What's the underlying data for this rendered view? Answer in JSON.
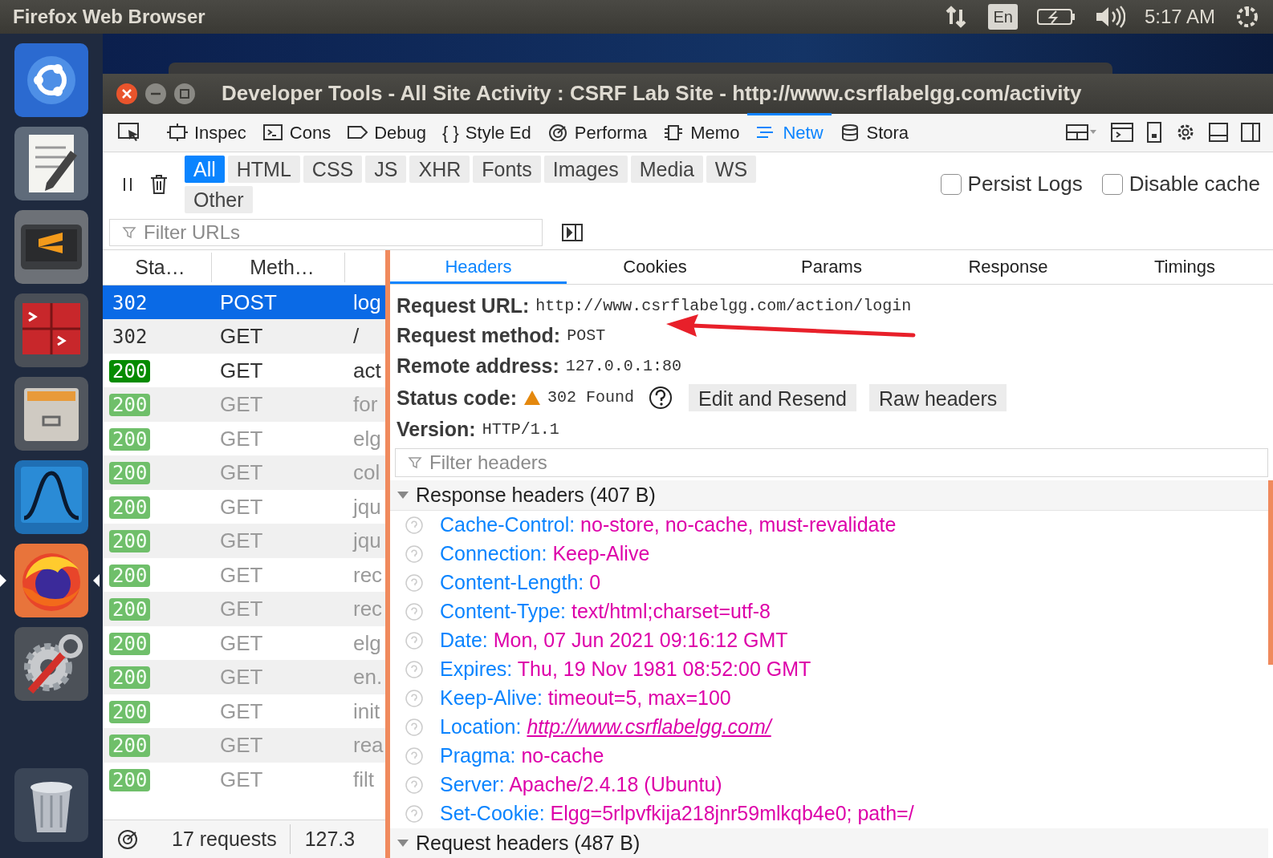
{
  "top_panel": {
    "app_title": "Firefox Web Browser",
    "keyboard_layout": "En",
    "clock": "5:17 AM"
  },
  "launcher": [
    {
      "kind": "dash",
      "active": false
    },
    {
      "kind": "editor",
      "active": false
    },
    {
      "kind": "sublime",
      "active": false
    },
    {
      "kind": "terminal",
      "active": false
    },
    {
      "kind": "files",
      "active": false
    },
    {
      "kind": "wireshark",
      "active": false
    },
    {
      "kind": "firefox",
      "active": true
    },
    {
      "kind": "settings",
      "active": false
    },
    {
      "kind": "trash",
      "active": false
    }
  ],
  "window": {
    "title": "Developer Tools - All Site Activity : CSRF Lab Site - http://www.csrflabelgg.com/activity"
  },
  "toolbox_tabs": [
    {
      "kind": "inspector",
      "label": "Inspec",
      "selected": false
    },
    {
      "kind": "console",
      "label": "Cons",
      "selected": false
    },
    {
      "kind": "debugger",
      "label": "Debug",
      "selected": false
    },
    {
      "kind": "style",
      "glyph": "{ }",
      "label": "Style Ed",
      "selected": false
    },
    {
      "kind": "performance",
      "label": "Performa",
      "selected": false
    },
    {
      "kind": "memory",
      "label": "Memo",
      "selected": false
    },
    {
      "kind": "network",
      "label": "Netw",
      "selected": true
    },
    {
      "kind": "storage",
      "label": "Stora",
      "selected": false
    }
  ],
  "filter_buttons": [
    {
      "label": "All",
      "selected": true
    },
    {
      "label": "HTML",
      "selected": false
    },
    {
      "label": "CSS",
      "selected": false
    },
    {
      "label": "JS",
      "selected": false
    },
    {
      "label": "XHR",
      "selected": false
    },
    {
      "label": "Fonts",
      "selected": false
    },
    {
      "label": "Images",
      "selected": false
    },
    {
      "label": "Media",
      "selected": false
    },
    {
      "label": "WS",
      "selected": false
    },
    {
      "label": "Other",
      "selected": false
    }
  ],
  "options": [
    {
      "label": "Persist Logs",
      "checked": false
    },
    {
      "label": "Disable cache",
      "checked": false
    }
  ],
  "url_filter": {
    "placeholder": "Filter URLs"
  },
  "request_table": {
    "columns": [
      "Sta…",
      "Meth…"
    ],
    "rows": [
      {
        "status": "302",
        "method": "POST",
        "file": "log",
        "kind": "plain",
        "cached": false,
        "selected": true
      },
      {
        "status": "302",
        "method": "GET",
        "file": "/",
        "kind": "plain",
        "cached": false,
        "selected": false
      },
      {
        "status": "200",
        "method": "GET",
        "file": "act",
        "kind": "badge",
        "cached": false,
        "selected": false
      },
      {
        "status": "200",
        "method": "GET",
        "file": "for",
        "kind": "badge",
        "cached": true,
        "selected": false
      },
      {
        "status": "200",
        "method": "GET",
        "file": "elg",
        "kind": "badge",
        "cached": true,
        "selected": false
      },
      {
        "status": "200",
        "method": "GET",
        "file": "col",
        "kind": "badge",
        "cached": true,
        "selected": false
      },
      {
        "status": "200",
        "method": "GET",
        "file": "jqu",
        "kind": "badge",
        "cached": true,
        "selected": false
      },
      {
        "status": "200",
        "method": "GET",
        "file": "jqu",
        "kind": "badge",
        "cached": true,
        "selected": false
      },
      {
        "status": "200",
        "method": "GET",
        "file": "rec",
        "kind": "badge",
        "cached": true,
        "selected": false
      },
      {
        "status": "200",
        "method": "GET",
        "file": "rec",
        "kind": "badge",
        "cached": true,
        "selected": false
      },
      {
        "status": "200",
        "method": "GET",
        "file": "elg",
        "kind": "badge",
        "cached": true,
        "selected": false
      },
      {
        "status": "200",
        "method": "GET",
        "file": "en.",
        "kind": "badge",
        "cached": true,
        "selected": false
      },
      {
        "status": "200",
        "method": "GET",
        "file": "init",
        "kind": "badge",
        "cached": true,
        "selected": false
      },
      {
        "status": "200",
        "method": "GET",
        "file": "rea",
        "kind": "badge",
        "cached": true,
        "selected": false
      },
      {
        "status": "200",
        "method": "GET",
        "file": "filt",
        "kind": "badge",
        "cached": true,
        "selected": false
      }
    ]
  },
  "status_bar": {
    "requests": "17 requests",
    "transferred": "127.3"
  },
  "details": {
    "tabs": [
      {
        "label": "Headers",
        "selected": true
      },
      {
        "label": "Cookies",
        "selected": false
      },
      {
        "label": "Params",
        "selected": false
      },
      {
        "label": "Response",
        "selected": false
      },
      {
        "label": "Timings",
        "selected": false
      }
    ],
    "summary": [
      {
        "kind": "plain",
        "label": "Request URL:",
        "value": "http://www.csrflabelgg.com/action/login"
      },
      {
        "kind": "plain",
        "label": "Request method:",
        "value": "POST"
      },
      {
        "kind": "plain",
        "label": "Remote address:",
        "value": "127.0.0.1:80"
      },
      {
        "kind": "status",
        "label": "Status code:",
        "value": "302 Found"
      },
      {
        "kind": "plain",
        "label": "Version:",
        "value": "HTTP/1.1"
      }
    ],
    "buttons": [
      "Edit and Resend",
      "Raw headers"
    ],
    "filter": {
      "placeholder": "Filter headers"
    },
    "sections": [
      {
        "title": "Response headers (407 B)",
        "expanded": true,
        "headers": [
          {
            "name": "Cache-Control:",
            "value": "no-store, no-cache, must-revalidate",
            "link": false
          },
          {
            "name": "Connection:",
            "value": "Keep-Alive",
            "link": false
          },
          {
            "name": "Content-Length:",
            "value": "0",
            "link": false
          },
          {
            "name": "Content-Type:",
            "value": "text/html;charset=utf-8",
            "link": false
          },
          {
            "name": "Date:",
            "value": "Mon, 07 Jun 2021 09:16:12 GMT",
            "link": false
          },
          {
            "name": "Expires:",
            "value": "Thu, 19 Nov 1981 08:52:00 GMT",
            "link": false
          },
          {
            "name": "Keep-Alive:",
            "value": "timeout=5, max=100",
            "link": false
          },
          {
            "name": "Location:",
            "value": "http://www.csrflabelgg.com/",
            "link": true
          },
          {
            "name": "Pragma:",
            "value": "no-cache",
            "link": false
          },
          {
            "name": "Server:",
            "value": "Apache/2.4.18 (Ubuntu)",
            "link": false
          },
          {
            "name": "Set-Cookie:",
            "value": "Elgg=5rlpvfkija218jnr59mlkqb4e0; path=/",
            "link": false
          }
        ]
      },
      {
        "title": "Request headers (487 B)",
        "expanded": true
      }
    ]
  }
}
